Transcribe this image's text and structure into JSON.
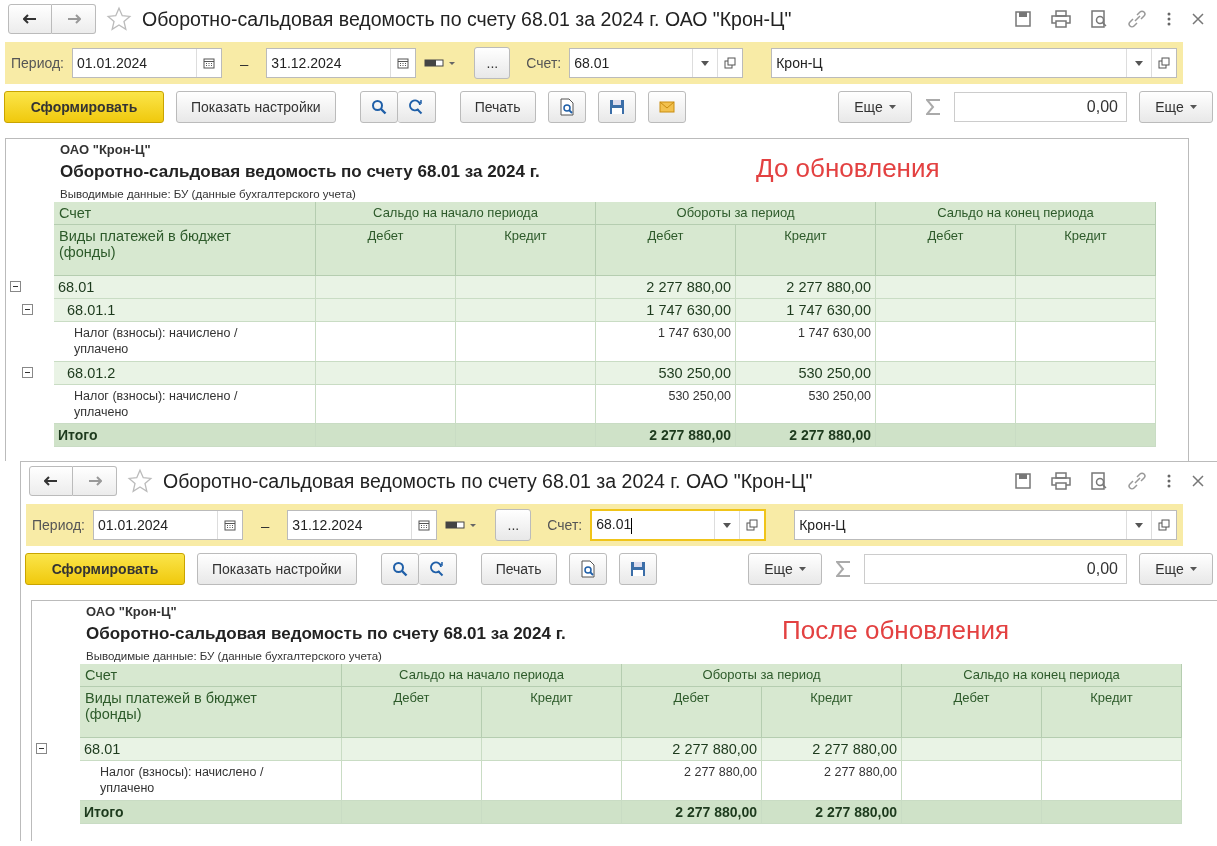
{
  "panels": [
    {
      "title": "Оборотно-сальдовая ведомость по счету 68.01 за 2024 г. ОАО \"Крон-Ц\"",
      "filters": {
        "period_label": "Период:",
        "date_from": "01.01.2024",
        "dash": "–",
        "date_to": "31.12.2024",
        "ellipsis": "...",
        "account_label": "Счет:",
        "account_value": "68.01",
        "account_focused": false,
        "org_value": "Крон-Ц"
      },
      "toolbar": {
        "generate": "Сформировать",
        "settings": "Показать настройки",
        "print": "Печать",
        "show_email": true,
        "more_left": "Еще",
        "sum": "0,00",
        "more_right": "Еще"
      },
      "report": {
        "org": "ОАО \"Крон-Ц\"",
        "title": "Оборотно-сальдовая ведомость по счету 68.01 за 2024 г.",
        "note": "Выводимые данные: БУ (данные бухгалтерского учета)",
        "annotation": "До обновления",
        "col_account": "Счет",
        "col_payment": "Виды платежей в бюджет (фонды)",
        "groups": [
          "Сальдо на начало периода",
          "Обороты за период",
          "Сальдо на конец периода"
        ],
        "subcolumns": [
          "Дебет",
          "Кредит",
          "Дебет",
          "Кредит",
          "Дебет",
          "Кредит"
        ],
        "rows": [
          {
            "kind": "account",
            "label": "68.01",
            "turnover_debit": "2 277 880,00",
            "turnover_credit": "2 277 880,00",
            "expanded": true,
            "children": [
              {
                "kind": "account",
                "label": "68.01.1",
                "turnover_debit": "1 747 630,00",
                "turnover_credit": "1 747 630,00",
                "expanded": true,
                "children": [
                  {
                    "kind": "detail",
                    "label": "Налог (взносы): начислено / уплачено",
                    "turnover_debit": "1 747 630,00",
                    "turnover_credit": "1 747 630,00"
                  }
                ]
              },
              {
                "kind": "account",
                "label": "68.01.2",
                "turnover_debit": "530 250,00",
                "turnover_credit": "530 250,00",
                "expanded": true,
                "children": [
                  {
                    "kind": "detail",
                    "label": "Налог (взносы): начислено / уплачено",
                    "turnover_debit": "530 250,00",
                    "turnover_credit": "530 250,00"
                  }
                ]
              }
            ]
          }
        ],
        "total": {
          "label": "Итого",
          "turnover_debit": "2 277 880,00",
          "turnover_credit": "2 277 880,00"
        }
      }
    },
    {
      "title": "Оборотно-сальдовая ведомость по счету 68.01 за 2024 г. ОАО \"Крон-Ц\"",
      "filters": {
        "period_label": "Период:",
        "date_from": "01.01.2024",
        "dash": "–",
        "date_to": "31.12.2024",
        "ellipsis": "...",
        "account_label": "Счет:",
        "account_value": "68.01",
        "account_focused": true,
        "org_value": "Крон-Ц"
      },
      "toolbar": {
        "generate": "Сформировать",
        "settings": "Показать настройки",
        "print": "Печать",
        "show_email": false,
        "more_left": "Еще",
        "sum": "0,00",
        "more_right": "Еще"
      },
      "report": {
        "org": "ОАО \"Крон-Ц\"",
        "title": "Оборотно-сальдовая ведомость по счету 68.01 за 2024 г.",
        "note": "Выводимые данные: БУ (данные бухгалтерского учета)",
        "annotation": "После обновления",
        "col_account": "Счет",
        "col_payment": "Виды платежей в бюджет (фонды)",
        "groups": [
          "Сальдо на начало периода",
          "Обороты за период",
          "Сальдо на конец периода"
        ],
        "subcolumns": [
          "Дебет",
          "Кредит",
          "Дебет",
          "Кредит",
          "Дебет",
          "Кредит"
        ],
        "rows": [
          {
            "kind": "account",
            "label": "68.01",
            "turnover_debit": "2 277 880,00",
            "turnover_credit": "2 277 880,00",
            "expanded": true,
            "children": [
              {
                "kind": "detail",
                "label": "Налог (взносы): начислено / уплачено",
                "turnover_debit": "2 277 880,00",
                "turnover_credit": "2 277 880,00"
              }
            ]
          }
        ],
        "total": {
          "label": "Итого",
          "turnover_debit": "2 277 880,00",
          "turnover_credit": "2 277 880,00"
        }
      }
    }
  ]
}
